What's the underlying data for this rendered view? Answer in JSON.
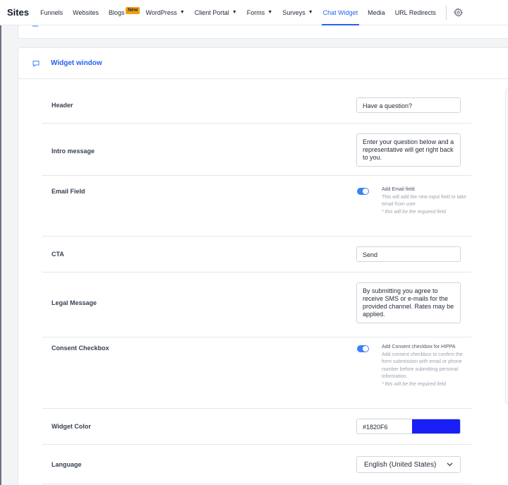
{
  "nav": {
    "brand": "Sites",
    "items": [
      {
        "label": "Funnels"
      },
      {
        "label": "Websites"
      },
      {
        "label": "Blogs",
        "badge": "New"
      },
      {
        "label": "WordPress",
        "dropdown": true
      },
      {
        "label": "Client Portal",
        "dropdown": true
      },
      {
        "label": "Forms",
        "dropdown": true
      },
      {
        "label": "Surveys",
        "dropdown": true
      },
      {
        "label": "Chat Widget",
        "active": true
      },
      {
        "label": "Media"
      },
      {
        "label": "URL Redirects"
      }
    ],
    "settings_icon": "gear-icon"
  },
  "card": {
    "title": "Widget window",
    "icon": "chat-bubble-icon"
  },
  "fields": {
    "header": {
      "label": "Header",
      "value": "Have a question?"
    },
    "intro": {
      "label": "Intro message",
      "value": "Enter your question below and a representative will get right back to you."
    },
    "email": {
      "label": "Email Field",
      "toggle_on": true,
      "title": "Add Email field",
      "description": "This will add the new input field to take email from user",
      "note": "* this will be the required field"
    },
    "cta": {
      "label": "CTA",
      "value": "Send"
    },
    "legal": {
      "label": "Legal Message",
      "value": "By submitting you agree to receive SMS or e-mails for the provided channel. Rates may be applied."
    },
    "consent": {
      "label": "Consent Checkbox",
      "toggle_on": true,
      "title": "Add Consent checkbox for HIPPA",
      "description": "Add consent checkbox to confirm the form submission with email or phone number before submitting personal information.",
      "note": "* this will be the required field"
    },
    "color": {
      "label": "Widget Color",
      "value": "#1820F6",
      "swatch": "#1820F6"
    },
    "language": {
      "label": "Language",
      "value": "English (United States)"
    }
  },
  "colors": {
    "accent": "#2563eb",
    "toggle": "#3b82f6"
  }
}
